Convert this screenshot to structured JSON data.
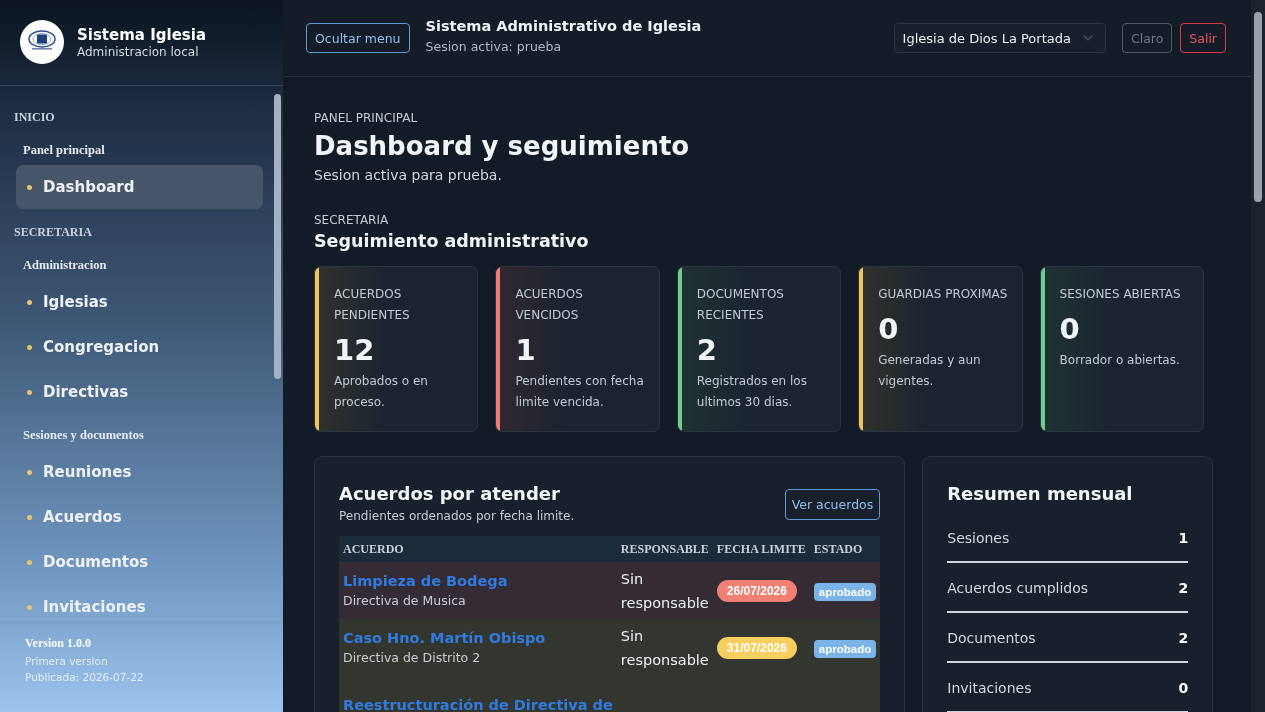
{
  "sidebar": {
    "brand": {
      "title": "Sistema Iglesia",
      "subtitle": "Administracion local"
    },
    "sections": [
      {
        "heading": "INICIO",
        "groups": [
          {
            "label": "Panel principal",
            "items": [
              {
                "label": "Dashboard",
                "selected": true
              }
            ]
          }
        ]
      },
      {
        "heading": "SECRETARIA",
        "groups": [
          {
            "label": "Administracion",
            "items": [
              {
                "label": "Iglesias",
                "selected": false
              },
              {
                "label": "Congregacion",
                "selected": false
              },
              {
                "label": "Directivas",
                "selected": false
              }
            ]
          },
          {
            "label": "Sesiones y documentos",
            "items": [
              {
                "label": "Reuniones",
                "selected": false
              },
              {
                "label": "Acuerdos",
                "selected": false
              },
              {
                "label": "Documentos",
                "selected": false
              },
              {
                "label": "Invitaciones",
                "selected": false
              }
            ]
          }
        ]
      }
    ],
    "footer": {
      "version": "Version 1.0.0",
      "note": "Primera version",
      "published": "Publicada: 2026-07-22"
    }
  },
  "topbar": {
    "toggle_button": "Ocultar menu",
    "title": "Sistema Administrativo de Iglesia",
    "subtitle": "Sesion activa: prueba",
    "church_select": {
      "value": "Iglesia de Dios La Portada"
    },
    "theme_button": "Claro",
    "logout_button": "Salir"
  },
  "page": {
    "eyebrow": "PANEL PRINCIPAL",
    "title": "Dashboard y seguimiento",
    "subtitle": "Sesion activa para prueba.",
    "section": {
      "eyebrow": "SECRETARIA",
      "title": "Seguimiento administrativo"
    },
    "stat_cards": [
      {
        "label": "ACUERDOS PENDIENTES",
        "value": "12",
        "note": "Aprobados o en proceso.",
        "color": "#f2c55c"
      },
      {
        "label": "ACUERDOS VENCIDOS",
        "value": "1",
        "note": "Pendientes con fecha limite vencida.",
        "color": "#ef7f76"
      },
      {
        "label": "DOCUMENTOS RECIENTES",
        "value": "2",
        "note": "Registrados en los ultimos 30 dias.",
        "color": "#6fcf8a"
      },
      {
        "label": "GUARDIAS PROXIMAS",
        "value": "0",
        "note": "Generadas y aun vigentes.",
        "color": "#f2c55c"
      },
      {
        "label": "SESIONES ABIERTAS",
        "value": "0",
        "note": "Borrador o abiertas.",
        "color": "#6fcf8a"
      }
    ],
    "agreements": {
      "title": "Acuerdos por atender",
      "subtitle": "Pendientes ordenados por fecha limite.",
      "button": "Ver acuerdos",
      "columns": [
        "ACUERDO",
        "RESPONSABLE",
        "FECHA LIMITE",
        "ESTADO"
      ],
      "rows": [
        {
          "kind": "overdue",
          "title": "Limpieza de Bodega",
          "group": "Directiva de Musica",
          "responsible": "Sin responsable",
          "deadline": "26/07/2026",
          "status": "aprobado"
        },
        {
          "kind": "upcoming",
          "title": "Caso Hno. Martín Obispo",
          "group": "Directiva de Distrito 2",
          "responsible": "Sin responsable",
          "deadline": "31/07/2026",
          "status": "aprobado"
        },
        {
          "kind": "upcoming",
          "title": "Reestructuración de Directiva de"
        }
      ]
    },
    "summary": {
      "title": "Resumen mensual",
      "items": [
        {
          "label": "Sesiones",
          "value": "1"
        },
        {
          "label": "Acuerdos cumplidos",
          "value": "2"
        },
        {
          "label": "Documentos",
          "value": "2"
        },
        {
          "label": "Invitaciones",
          "value": "0"
        }
      ]
    }
  }
}
